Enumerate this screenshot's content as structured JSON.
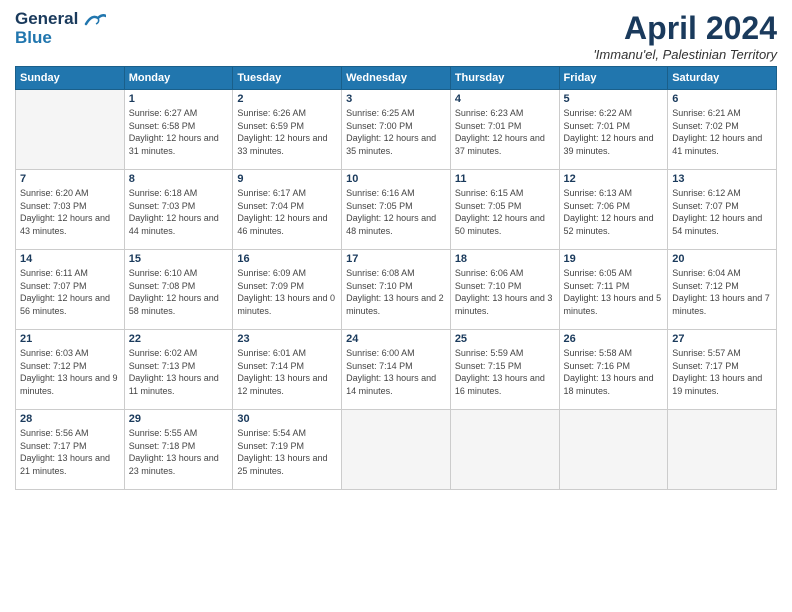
{
  "logo": {
    "line1": "General",
    "line2": "Blue"
  },
  "title": "April 2024",
  "subtitle": "'Immanu'el, Palestinian Territory",
  "days_of_week": [
    "Sunday",
    "Monday",
    "Tuesday",
    "Wednesday",
    "Thursday",
    "Friday",
    "Saturday"
  ],
  "weeks": [
    [
      {
        "day": "",
        "empty": true
      },
      {
        "day": "1",
        "sunrise": "6:27 AM",
        "sunset": "6:58 PM",
        "daylight": "12 hours and 31 minutes."
      },
      {
        "day": "2",
        "sunrise": "6:26 AM",
        "sunset": "6:59 PM",
        "daylight": "12 hours and 33 minutes."
      },
      {
        "day": "3",
        "sunrise": "6:25 AM",
        "sunset": "7:00 PM",
        "daylight": "12 hours and 35 minutes."
      },
      {
        "day": "4",
        "sunrise": "6:23 AM",
        "sunset": "7:01 PM",
        "daylight": "12 hours and 37 minutes."
      },
      {
        "day": "5",
        "sunrise": "6:22 AM",
        "sunset": "7:01 PM",
        "daylight": "12 hours and 39 minutes."
      },
      {
        "day": "6",
        "sunrise": "6:21 AM",
        "sunset": "7:02 PM",
        "daylight": "12 hours and 41 minutes."
      }
    ],
    [
      {
        "day": "7",
        "sunrise": "6:20 AM",
        "sunset": "7:03 PM",
        "daylight": "12 hours and 43 minutes."
      },
      {
        "day": "8",
        "sunrise": "6:18 AM",
        "sunset": "7:03 PM",
        "daylight": "12 hours and 44 minutes."
      },
      {
        "day": "9",
        "sunrise": "6:17 AM",
        "sunset": "7:04 PM",
        "daylight": "12 hours and 46 minutes."
      },
      {
        "day": "10",
        "sunrise": "6:16 AM",
        "sunset": "7:05 PM",
        "daylight": "12 hours and 48 minutes."
      },
      {
        "day": "11",
        "sunrise": "6:15 AM",
        "sunset": "7:05 PM",
        "daylight": "12 hours and 50 minutes."
      },
      {
        "day": "12",
        "sunrise": "6:13 AM",
        "sunset": "7:06 PM",
        "daylight": "12 hours and 52 minutes."
      },
      {
        "day": "13",
        "sunrise": "6:12 AM",
        "sunset": "7:07 PM",
        "daylight": "12 hours and 54 minutes."
      }
    ],
    [
      {
        "day": "14",
        "sunrise": "6:11 AM",
        "sunset": "7:07 PM",
        "daylight": "12 hours and 56 minutes."
      },
      {
        "day": "15",
        "sunrise": "6:10 AM",
        "sunset": "7:08 PM",
        "daylight": "12 hours and 58 minutes."
      },
      {
        "day": "16",
        "sunrise": "6:09 AM",
        "sunset": "7:09 PM",
        "daylight": "13 hours and 0 minutes."
      },
      {
        "day": "17",
        "sunrise": "6:08 AM",
        "sunset": "7:10 PM",
        "daylight": "13 hours and 2 minutes."
      },
      {
        "day": "18",
        "sunrise": "6:06 AM",
        "sunset": "7:10 PM",
        "daylight": "13 hours and 3 minutes."
      },
      {
        "day": "19",
        "sunrise": "6:05 AM",
        "sunset": "7:11 PM",
        "daylight": "13 hours and 5 minutes."
      },
      {
        "day": "20",
        "sunrise": "6:04 AM",
        "sunset": "7:12 PM",
        "daylight": "13 hours and 7 minutes."
      }
    ],
    [
      {
        "day": "21",
        "sunrise": "6:03 AM",
        "sunset": "7:12 PM",
        "daylight": "13 hours and 9 minutes."
      },
      {
        "day": "22",
        "sunrise": "6:02 AM",
        "sunset": "7:13 PM",
        "daylight": "13 hours and 11 minutes."
      },
      {
        "day": "23",
        "sunrise": "6:01 AM",
        "sunset": "7:14 PM",
        "daylight": "13 hours and 12 minutes."
      },
      {
        "day": "24",
        "sunrise": "6:00 AM",
        "sunset": "7:14 PM",
        "daylight": "13 hours and 14 minutes."
      },
      {
        "day": "25",
        "sunrise": "5:59 AM",
        "sunset": "7:15 PM",
        "daylight": "13 hours and 16 minutes."
      },
      {
        "day": "26",
        "sunrise": "5:58 AM",
        "sunset": "7:16 PM",
        "daylight": "13 hours and 18 minutes."
      },
      {
        "day": "27",
        "sunrise": "5:57 AM",
        "sunset": "7:17 PM",
        "daylight": "13 hours and 19 minutes."
      }
    ],
    [
      {
        "day": "28",
        "sunrise": "5:56 AM",
        "sunset": "7:17 PM",
        "daylight": "13 hours and 21 minutes."
      },
      {
        "day": "29",
        "sunrise": "5:55 AM",
        "sunset": "7:18 PM",
        "daylight": "13 hours and 23 minutes."
      },
      {
        "day": "30",
        "sunrise": "5:54 AM",
        "sunset": "7:19 PM",
        "daylight": "13 hours and 25 minutes."
      },
      {
        "day": "",
        "empty": true
      },
      {
        "day": "",
        "empty": true
      },
      {
        "day": "",
        "empty": true
      },
      {
        "day": "",
        "empty": true
      }
    ]
  ]
}
